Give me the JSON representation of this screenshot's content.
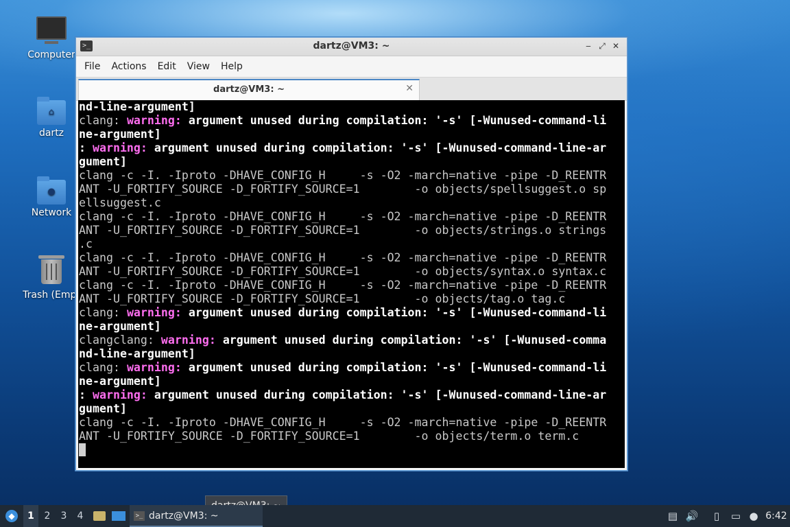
{
  "desktop": {
    "icons": [
      {
        "label": "Computer"
      },
      {
        "label": "dartz"
      },
      {
        "label": "Network"
      },
      {
        "label": "Trash (Empt"
      }
    ]
  },
  "window": {
    "title": "dartz@VM3: ~",
    "controls": {
      "minimize": "‒",
      "maximize": "⤢",
      "close": "✕"
    },
    "menu": [
      "File",
      "Actions",
      "Edit",
      "View",
      "Help"
    ],
    "tab": {
      "title": "dartz@VM3: ~",
      "close": "✕"
    }
  },
  "terminal": {
    "lines": [
      [
        {
          "t": "nd-line-argument]",
          "s": "b"
        }
      ],
      [
        {
          "t": "clang: ",
          "s": "n"
        },
        {
          "t": "warning:",
          "s": "m"
        },
        {
          "t": " argument unused during compilation: '-s' [-Wunused-command-li",
          "s": "b"
        }
      ],
      [
        {
          "t": "ne-argument]",
          "s": "b"
        }
      ],
      [
        {
          "t": ": ",
          "s": "b"
        },
        {
          "t": "warning:",
          "s": "m"
        },
        {
          "t": " argument unused during compilation: '-s' [-Wunused-command-line-ar",
          "s": "b"
        }
      ],
      [
        {
          "t": "gument]",
          "s": "b"
        }
      ],
      [
        {
          "t": "clang -c -I. -Iproto -DHAVE_CONFIG_H     -s -O2 -march=native -pipe -D_REENTR",
          "s": "n"
        }
      ],
      [
        {
          "t": "ANT -U_FORTIFY_SOURCE -D_FORTIFY_SOURCE=1        -o objects/spellsuggest.o sp",
          "s": "n"
        }
      ],
      [
        {
          "t": "ellsuggest.c",
          "s": "n"
        }
      ],
      [
        {
          "t": "clang -c -I. -Iproto -DHAVE_CONFIG_H     -s -O2 -march=native -pipe -D_REENTR",
          "s": "n"
        }
      ],
      [
        {
          "t": "ANT -U_FORTIFY_SOURCE -D_FORTIFY_SOURCE=1        -o objects/strings.o strings",
          "s": "n"
        }
      ],
      [
        {
          "t": ".c",
          "s": "n"
        }
      ],
      [
        {
          "t": "clang -c -I. -Iproto -DHAVE_CONFIG_H     -s -O2 -march=native -pipe -D_REENTR",
          "s": "n"
        }
      ],
      [
        {
          "t": "ANT -U_FORTIFY_SOURCE -D_FORTIFY_SOURCE=1        -o objects/syntax.o syntax.c",
          "s": "n"
        }
      ],
      [
        {
          "t": "clang -c -I. -Iproto -DHAVE_CONFIG_H     -s -O2 -march=native -pipe -D_REENTR",
          "s": "n"
        }
      ],
      [
        {
          "t": "ANT -U_FORTIFY_SOURCE -D_FORTIFY_SOURCE=1        -o objects/tag.o tag.c",
          "s": "n"
        }
      ],
      [
        {
          "t": "clang: ",
          "s": "n"
        },
        {
          "t": "warning:",
          "s": "m"
        },
        {
          "t": " argument unused during compilation: '-s' [-Wunused-command-li",
          "s": "b"
        }
      ],
      [
        {
          "t": "ne-argument]",
          "s": "b"
        }
      ],
      [
        {
          "t": "clangclang: ",
          "s": "n"
        },
        {
          "t": "warning:",
          "s": "m"
        },
        {
          "t": " argument unused during compilation: '-s' [-Wunused-comma",
          "s": "b"
        }
      ],
      [
        {
          "t": "nd-line-argument]",
          "s": "b"
        }
      ],
      [
        {
          "t": "clang: ",
          "s": "n"
        },
        {
          "t": "warning:",
          "s": "m"
        },
        {
          "t": " argument unused during compilation: '-s' [-Wunused-command-li",
          "s": "b"
        }
      ],
      [
        {
          "t": "ne-argument]",
          "s": "b"
        }
      ],
      [
        {
          "t": ": ",
          "s": "b"
        },
        {
          "t": "warning:",
          "s": "m"
        },
        {
          "t": " argument unused during compilation: '-s' [-Wunused-command-line-ar",
          "s": "b"
        }
      ],
      [
        {
          "t": "gument]",
          "s": "b"
        }
      ],
      [
        {
          "t": "clang -c -I. -Iproto -DHAVE_CONFIG_H     -s -O2 -march=native -pipe -D_REENTR",
          "s": "n"
        }
      ],
      [
        {
          "t": "ANT -U_FORTIFY_SOURCE -D_FORTIFY_SOURCE=1        -o objects/term.o term.c",
          "s": "n"
        }
      ]
    ],
    "colors": {
      "background": "#000000",
      "warning": "#ff6ef0",
      "bold": "#ffffff",
      "normal": "#c8c8c8"
    }
  },
  "taskbar": {
    "workspaces": [
      "1",
      "2",
      "3",
      "4"
    ],
    "active_workspace": "1",
    "task_label": "dartz@VM3: ~",
    "tooltip": "dartz@VM3: ~",
    "clock": "6:42",
    "icons": [
      "whisker-menu-icon",
      "file-manager-icon",
      "desktop-icon",
      "clipboard-icon",
      "volume-icon",
      "notes-icon",
      "network-icon",
      "notification-icon"
    ]
  }
}
